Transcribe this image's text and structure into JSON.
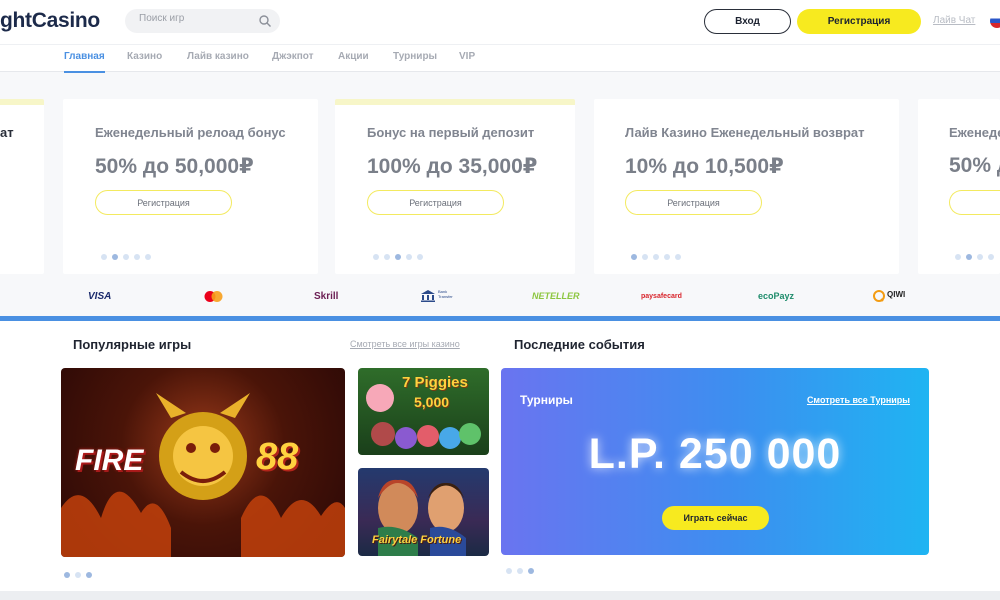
{
  "header": {
    "logo_text": "ghtCasino",
    "search_placeholder": "Поиск игр",
    "login_label": "Вход",
    "register_label": "Регистрация",
    "live_chat_label": "Лайв Чат"
  },
  "nav": {
    "items": [
      "Главная",
      "Казино",
      "Лайв казино",
      "Джэкпот",
      "Акции",
      "Турниры",
      "VIP"
    ],
    "active": "Главная"
  },
  "promos": [
    {
      "title": "ат",
      "amount": "",
      "button": ""
    },
    {
      "title": "Еженедельный релоад бонус",
      "amount": "50% до 50,000₽",
      "button": "Регистрация"
    },
    {
      "title": "Бонус на первый депозит",
      "amount": "100% до 35,000₽",
      "button": "Регистрация"
    },
    {
      "title": "Лайв Казино Еженедельный возврат",
      "amount": "10% до 10,500₽",
      "button": "Регистрация"
    },
    {
      "title": "Еженеде",
      "amount": "50% д",
      "button": ""
    }
  ],
  "payments": [
    "VISA",
    "Skrill",
    "Bank Transfer",
    "NETELLER",
    "paysafecard",
    "ecoPayz",
    "QIWI"
  ],
  "popular": {
    "title": "Популярные игры",
    "see_all": "Смотреть все игры казино",
    "games": [
      "FIRE 88",
      "7 Piggies 5,000",
      "Fairytale Fortune"
    ]
  },
  "events": {
    "title": "Последние события",
    "tour_title": "Турниры",
    "tour_link": "Смотреть все Турниры",
    "tour_amount": "L.P. 250 000",
    "tour_button": "Играть сейчас"
  },
  "colors": {
    "accent_yellow": "#f7ea1f",
    "accent_blue": "#4a90e2"
  }
}
